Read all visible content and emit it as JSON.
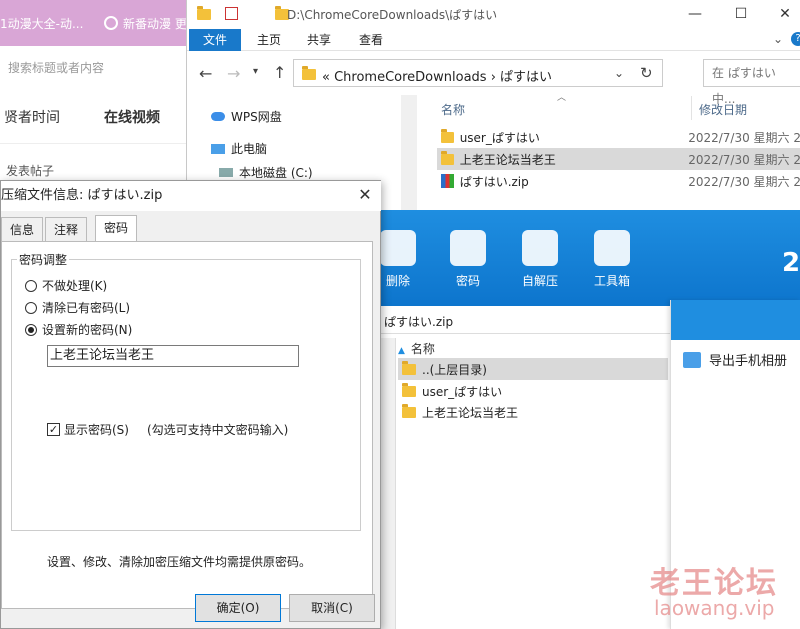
{
  "browser": {
    "tab1": "1动漫大全-动...",
    "tab2": "新番动漫 更...",
    "search_placeholder": "搜索标题或者内容",
    "nav": [
      "贤者时间",
      "在线视频"
    ],
    "post_link": "发表帖子"
  },
  "explorer": {
    "title_path": "D:\\ChromeCoreDownloads\\ぱすはい",
    "ribbon_tabs": [
      "文件",
      "主页",
      "共享",
      "查看"
    ],
    "address": "« ChromeCoreDownloads › ぱすはい",
    "search_placeholder": "在 ぱすはい 中...",
    "tree": [
      "WPS网盘",
      "此电脑",
      "本地磁盘 (C:)"
    ],
    "columns": {
      "name": "名称",
      "modified": "修改日期"
    },
    "files": [
      {
        "name": "user_ぱすはい",
        "modified": "2022/7/30 星期六 2",
        "icon": "folder-icon"
      },
      {
        "name": "上老王论坛当老王",
        "modified": "2022/7/30 星期六 2",
        "icon": "folder-icon"
      },
      {
        "name": "ぱすはい.zip",
        "modified": "2022/7/30 星期六 2",
        "icon": "archive-icon"
      }
    ]
  },
  "zipapp": {
    "tools": [
      "删除",
      "密码",
      "自解压",
      "工具箱"
    ],
    "path": "ぱすはい.zip",
    "column_name": "名称",
    "rows": [
      "..(上层目录)",
      "user_ぱすはい",
      "上老王论坛当老王"
    ],
    "export_label": "导出手机相册",
    "brand_color": "#1f8ee0"
  },
  "dialog": {
    "title": "压缩文件信息: ぱすはい.zip",
    "tabs": [
      "信息",
      "注释",
      "密码"
    ],
    "group_title": "密码调整",
    "options": [
      "不做处理(K)",
      "清除已有密码(L)",
      "设置新的密码(N)"
    ],
    "password_value": "上老王论坛当老王",
    "show_password": "显示密码(S)",
    "show_password_hint": "(勾选可支持中文密码输入)",
    "note": "设置、修改、清除加密压缩文件均需提供原密码。",
    "ok": "确定(O)",
    "cancel": "取消(C)"
  },
  "watermark": {
    "line1": "老王论坛",
    "line2": "laowang.vip"
  }
}
